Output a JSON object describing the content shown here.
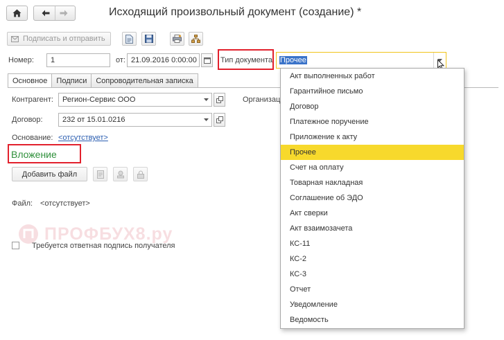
{
  "nav": {
    "home_icon": "home-icon",
    "back_icon": "arrow-left-icon",
    "forward_icon": "arrow-right-icon"
  },
  "window": {
    "title": "Исходящий произвольный документ (создание) *"
  },
  "toolbar": {
    "sign_send_label": "Подписать и отправить",
    "icons": [
      "document-icon",
      "save-icon",
      "print-icon",
      "structure-icon"
    ]
  },
  "header": {
    "number_label": "Номер:",
    "number_value": "1",
    "from_label": "от:",
    "date_value": "21.09.2016  0:00:00",
    "doc_type_label": "Тип документа:",
    "doc_type_value": "Прочее"
  },
  "tabs": [
    {
      "label": "Основное",
      "active": true
    },
    {
      "label": "Подписи",
      "active": false
    },
    {
      "label": "Сопроводительная записка",
      "active": false
    }
  ],
  "form": {
    "counterparty_label": "Контрагент:",
    "counterparty_value": "Регион-Сервис  ООО",
    "organization_label": "Организац",
    "contract_label": "Договор:",
    "contract_value": "232 от 15.01.0216",
    "basis_label": "Основание:",
    "basis_value": "<отсутствует>",
    "attachment_heading": "Вложение",
    "add_file_label": "Добавить файл",
    "file_label": "Файл:",
    "file_value": "<отсутствует>",
    "reply_sign_label": "Требуется ответная подпись получателя",
    "reply_sign_checked": false
  },
  "doc_types": {
    "selected": "Прочее",
    "options": [
      "Акт выполненных работ",
      "Гарантийное письмо",
      "Договор",
      "Платежное поручение",
      "Приложение к акту",
      "Прочее",
      "Счет на оплату",
      "Товарная накладная",
      "Соглашение об ЭДО",
      "Акт сверки",
      "Акт взаимозачета",
      "КС-11",
      "КС-2",
      "КС-3",
      "Отчет",
      "Уведомление",
      "Ведомость"
    ]
  },
  "watermark": {
    "text": "ПРОФБУХ8.ру"
  },
  "colors": {
    "accent_green": "#2e8f3a",
    "highlight": "#f7d92c",
    "annotation_red": "#e2202c",
    "link": "#2a5db0"
  }
}
